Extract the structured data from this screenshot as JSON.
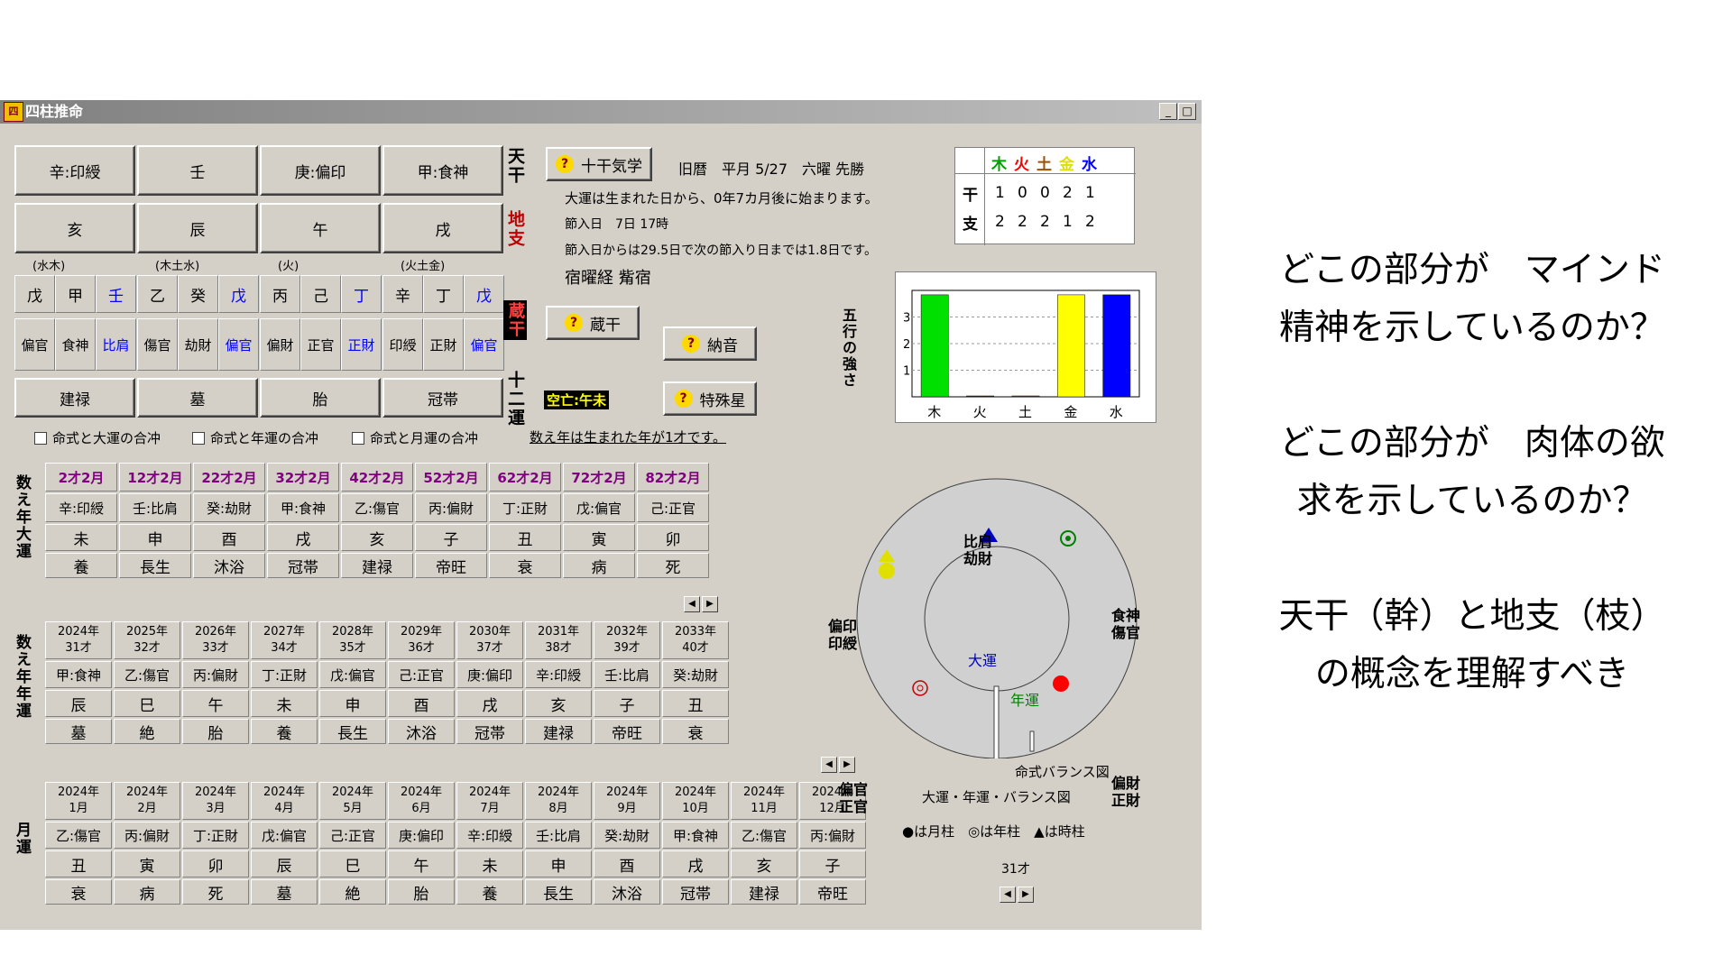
{
  "window": {
    "title": "四柱推命",
    "icon": "app-logo",
    "min_label": "_",
    "max_label": "□"
  },
  "pillars": {
    "stem_row": [
      "辛:印綬",
      "壬",
      "庚:偏印",
      "甲:食神"
    ],
    "branch_row": [
      "亥",
      "辰",
      "午",
      "戌"
    ],
    "elements": [
      "(水木)",
      "(木土水)",
      "(火)",
      "(火土金)"
    ],
    "hidden_stems": [
      "戊",
      "甲",
      "壬",
      "乙",
      "癸",
      "戊",
      "丙",
      "己",
      "丁",
      "辛",
      "丁",
      "戊"
    ],
    "hidden_stars": [
      "偏官",
      "食神",
      "比肩",
      "傷官",
      "劫財",
      "偏官",
      "偏財",
      "正官",
      "正財",
      "印綬",
      "正財",
      "偏官"
    ],
    "twelve_fortunes": [
      "建禄",
      "墓",
      "胎",
      "冠帯"
    ]
  },
  "side_labels": {
    "tenkan": "天干",
    "chishi": "地支",
    "zoukan": "蔵干",
    "juuni": "十二運"
  },
  "buttons": {
    "jikkan": "十干気学",
    "zoukan": "蔵干",
    "nacchin": "納音",
    "tokushu": "特殊星"
  },
  "info": {
    "calendar": "旧暦　平月 5/27　六曜 先勝",
    "daiun_start": "大運は生まれた日から、0年7カ月後に始まります。",
    "setsuiri": "節入日　7日 17時",
    "setsuiri_days": "節入日からは29.5日で次の節入り日までは1.8日です。",
    "shukuyo": "宿曜経 觜宿",
    "kuubou": "空亡:午未",
    "age_note": "数え年は生まれた年が1才です。"
  },
  "checkboxes": [
    "命式と大運の合冲",
    "命式と年運の合冲",
    "命式と月運の合冲"
  ],
  "gogyo_table": {
    "headers": [
      "木",
      "火",
      "土",
      "金",
      "水"
    ],
    "header_colors": [
      "#00a000",
      "#ff0000",
      "#a05000",
      "#e0e000",
      "#0000ff"
    ],
    "row_labels": [
      "干",
      "支"
    ],
    "kan": [
      "1",
      "0",
      "0",
      "2",
      "1"
    ],
    "shi": [
      "2",
      "2",
      "2",
      "1",
      "2"
    ]
  },
  "gogyo_chart": {
    "title": "五行の強さ",
    "categories": [
      "木",
      "火",
      "土",
      "金",
      "水"
    ],
    "values": [
      3.8,
      0,
      0,
      3.8,
      3.8
    ],
    "colors": [
      "#00e000",
      "#c00000",
      "#806000",
      "#ffff00",
      "#0000ff"
    ],
    "ylim": [
      0,
      4
    ],
    "yticks": [
      "1",
      "2",
      "3"
    ]
  },
  "daiun": {
    "label": "数え年大運",
    "ages": [
      "2才2月",
      "12才2月",
      "22才2月",
      "32才2月",
      "42才2月",
      "52才2月",
      "62才2月",
      "72才2月",
      "82才2月"
    ],
    "stems": [
      "辛:印綬",
      "壬:比肩",
      "癸:劫財",
      "甲:食神",
      "乙:傷官",
      "丙:偏財",
      "丁:正財",
      "戊:偏官",
      "己:正官"
    ],
    "branches": [
      "未",
      "申",
      "酉",
      "戌",
      "亥",
      "子",
      "丑",
      "寅",
      "卯"
    ],
    "fortunes": [
      "養",
      "長生",
      "沐浴",
      "冠帯",
      "建禄",
      "帝旺",
      "衰",
      "病",
      "死"
    ]
  },
  "nenun": {
    "label": "数え年年運",
    "years": [
      "2024年",
      "2025年",
      "2026年",
      "2027年",
      "2028年",
      "2029年",
      "2030年",
      "2031年",
      "2032年",
      "2033年"
    ],
    "ages": [
      "31才",
      "32才",
      "33才",
      "34才",
      "35才",
      "36才",
      "37才",
      "38才",
      "39才",
      "40才"
    ],
    "stems": [
      "甲:食神",
      "乙:傷官",
      "丙:偏財",
      "丁:正財",
      "戊:偏官",
      "己:正官",
      "庚:偏印",
      "辛:印綬",
      "壬:比肩",
      "癸:劫財"
    ],
    "branches": [
      "辰",
      "巳",
      "午",
      "未",
      "申",
      "酉",
      "戌",
      "亥",
      "子",
      "丑"
    ],
    "fortunes": [
      "墓",
      "絶",
      "胎",
      "養",
      "長生",
      "沐浴",
      "冠帯",
      "建禄",
      "帝旺",
      "衰"
    ]
  },
  "getsuun": {
    "label": "月運",
    "years": [
      "2024年",
      "2024年",
      "2024年",
      "2024年",
      "2024年",
      "2024年",
      "2024年",
      "2024年",
      "2024年",
      "2024年",
      "2024年",
      "2024年"
    ],
    "months": [
      "1月",
      "2月",
      "3月",
      "4月",
      "5月",
      "6月",
      "7月",
      "8月",
      "9月",
      "10月",
      "11月",
      "12月"
    ],
    "stems": [
      "乙:傷官",
      "丙:偏財",
      "丁:正財",
      "戊:偏官",
      "己:正官",
      "庚:偏印",
      "辛:印綬",
      "壬:比肩",
      "癸:劫財",
      "甲:食神",
      "乙:傷官",
      "丙:偏財"
    ],
    "branches": [
      "丑",
      "寅",
      "卯",
      "辰",
      "巳",
      "午",
      "未",
      "申",
      "酉",
      "戌",
      "亥",
      "子"
    ],
    "fortunes": [
      "衰",
      "病",
      "死",
      "墓",
      "絶",
      "胎",
      "養",
      "長生",
      "沐浴",
      "冠帯",
      "建禄",
      "帝旺"
    ]
  },
  "balance": {
    "labels": {
      "top": "比肩\n劫財",
      "right_top": "食神\n傷官",
      "right_bottom": "偏財\n正財",
      "left_top": "偏印\n印綬",
      "left_bottom": "偏官\n正官"
    },
    "inner": {
      "daiun": "大運",
      "nenun": "年運"
    },
    "caption_meishiki": "命式バランス図",
    "caption_main": "大運・年運・バランス図",
    "legend": "●は月柱　◎は年柱　▲は時柱",
    "age": "31才"
  },
  "notes": [
    "どこの部分が　マインド\n精神を示しているのか？",
    "どこの部分が　肉体の欲\n求を示しているのか？",
    "天干（幹）と地支（枝）\nの概念を理解すべき"
  ]
}
